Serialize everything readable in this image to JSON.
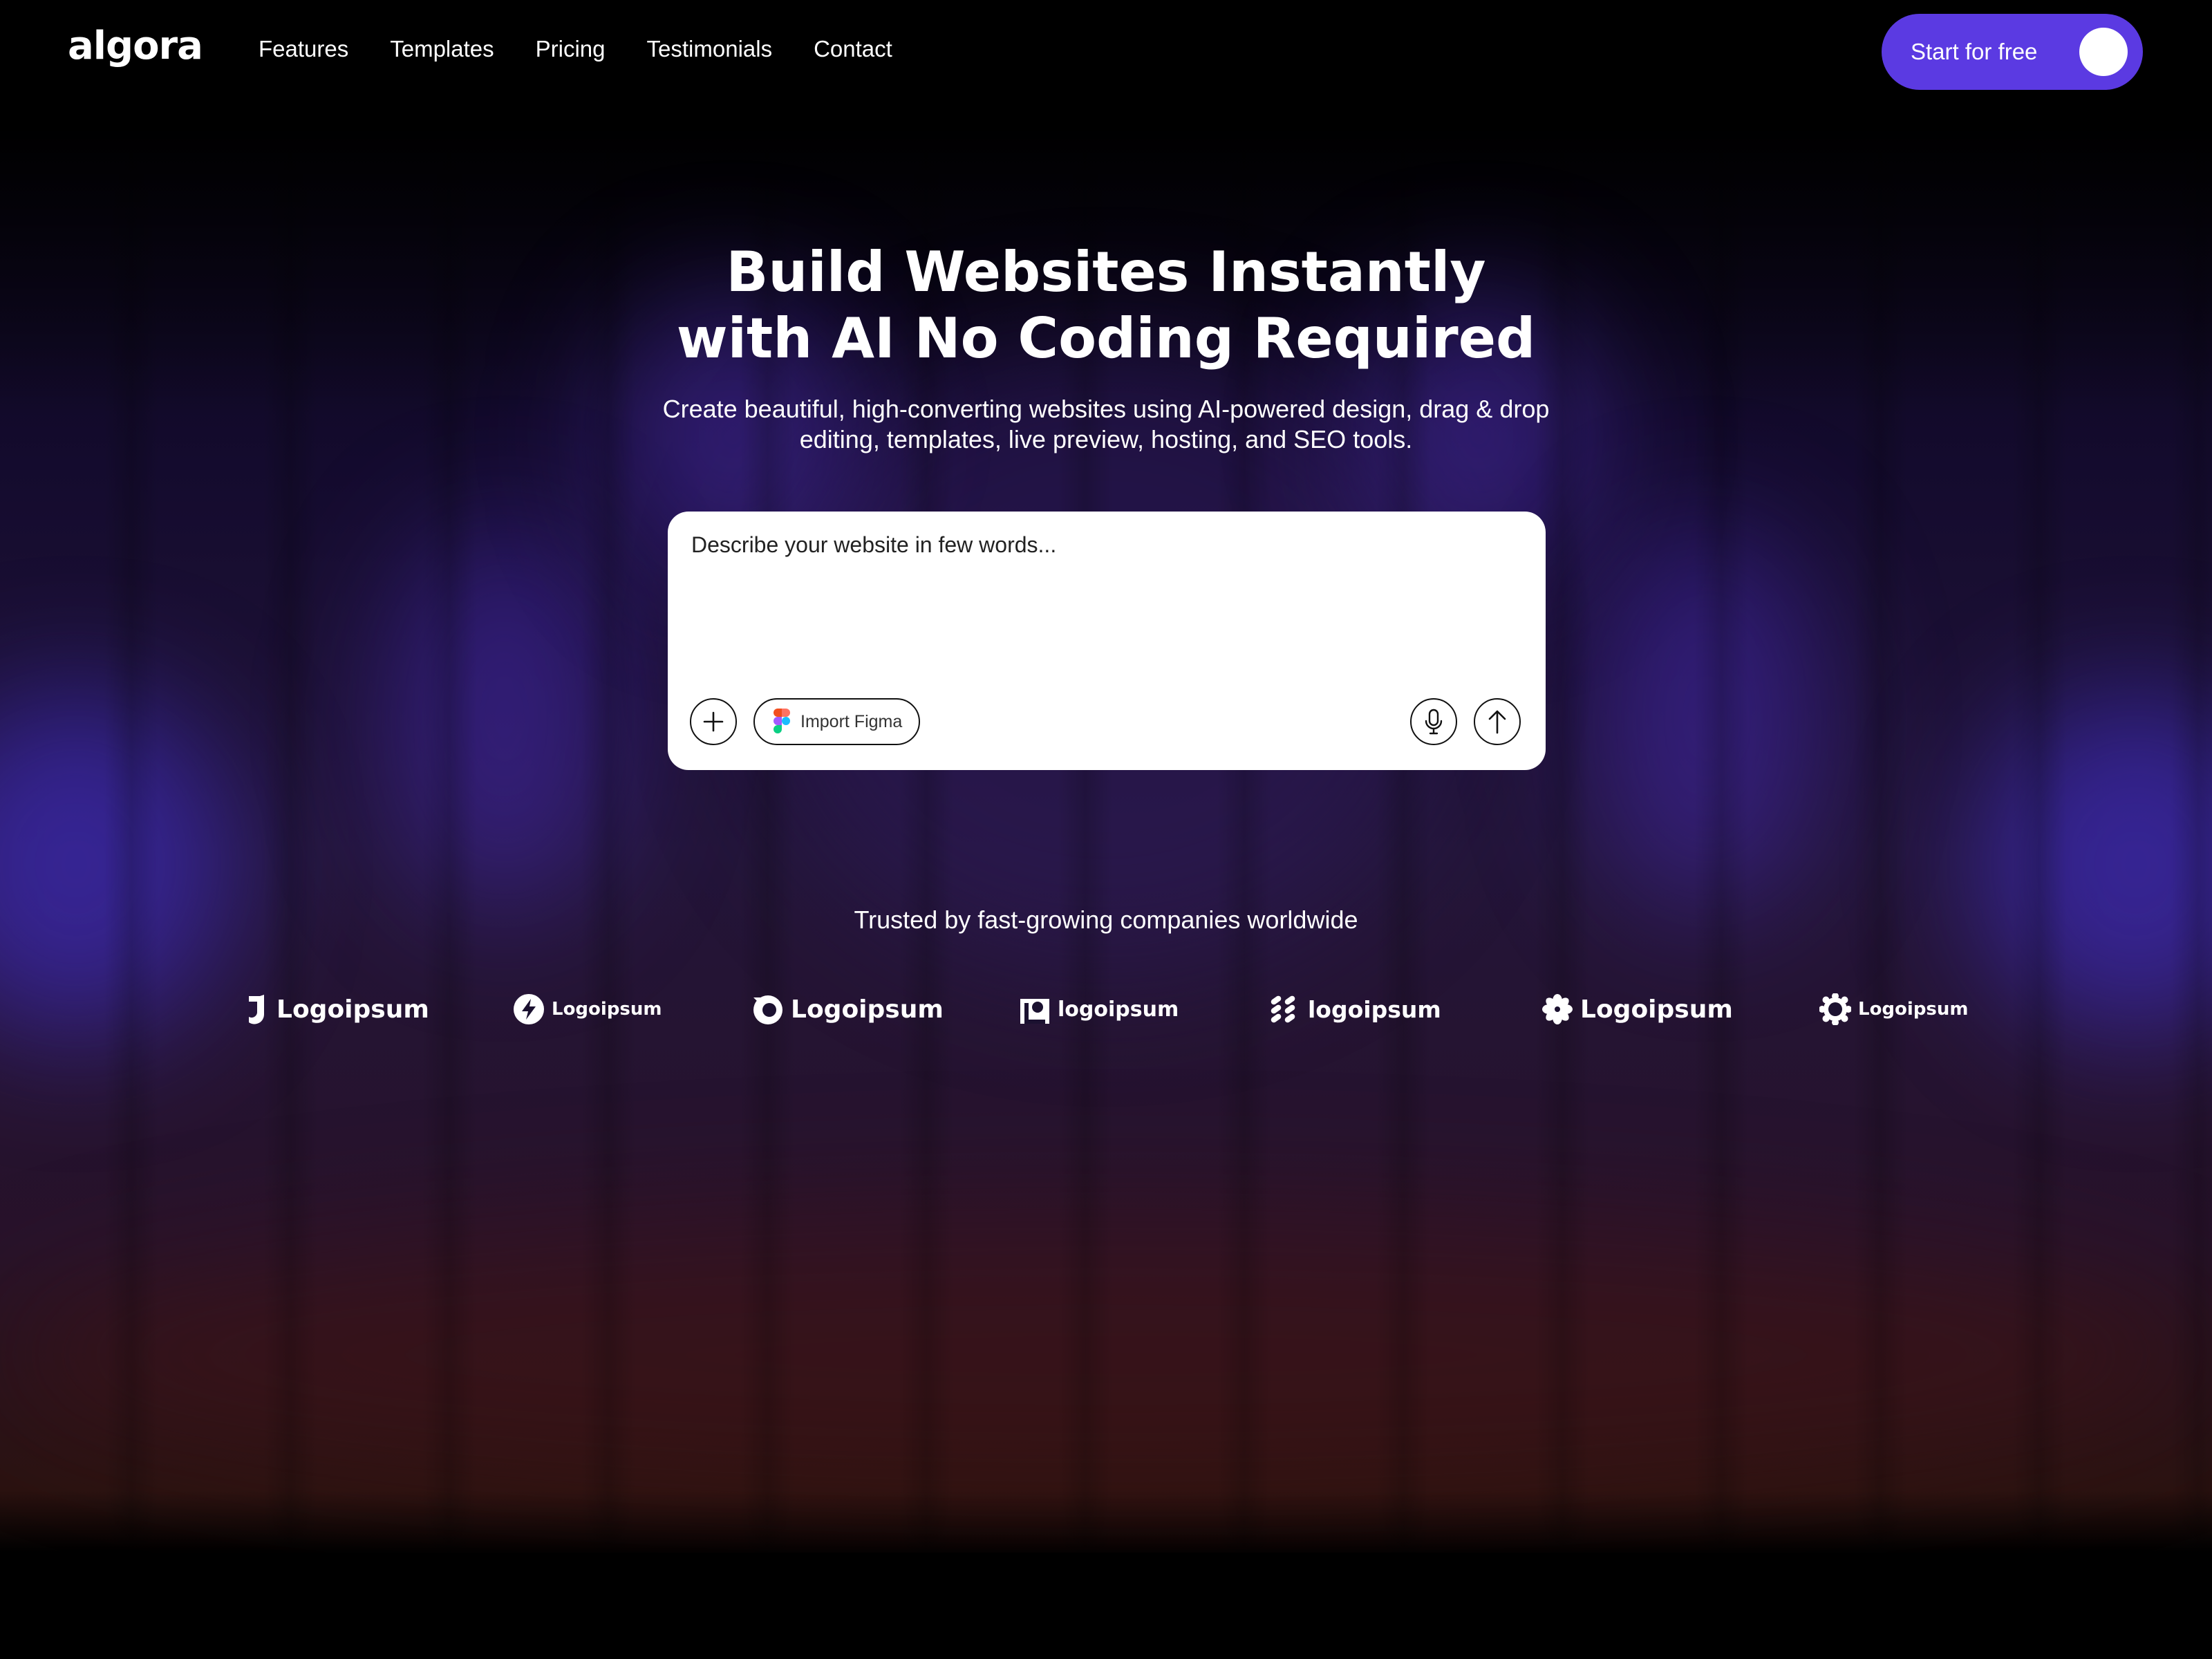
{
  "brand": {
    "name": "algora"
  },
  "nav": {
    "links": [
      "Features",
      "Templates",
      "Pricing",
      "Testimonials",
      "Contact"
    ],
    "cta_label": "Start for free"
  },
  "hero": {
    "title_line1": "Build Websites Instantly",
    "title_line2": "with AI No Coding Required",
    "subtitle": "Create beautiful, high-converting websites using AI-powered design, drag & drop editing, templates, live preview, hosting, and SEO tools."
  },
  "prompt": {
    "placeholder": "Describe your website in few words...",
    "import_label": "Import Figma",
    "icons": [
      "plus-icon",
      "figma-icon",
      "microphone-icon",
      "arrow-up-icon"
    ]
  },
  "trusted": {
    "heading": "Trusted by fast-growing companies worldwide",
    "logos": [
      "Logoipsum",
      "Logoipsum",
      "Logoipsum",
      "logoipsum",
      "logoipsum",
      "Logoipsum",
      "Logoipsum"
    ]
  },
  "colors": {
    "accent": "#5b3ae2",
    "background": "#000000",
    "glow": "#4b35d4",
    "prompt_bg": "#ffffff"
  }
}
